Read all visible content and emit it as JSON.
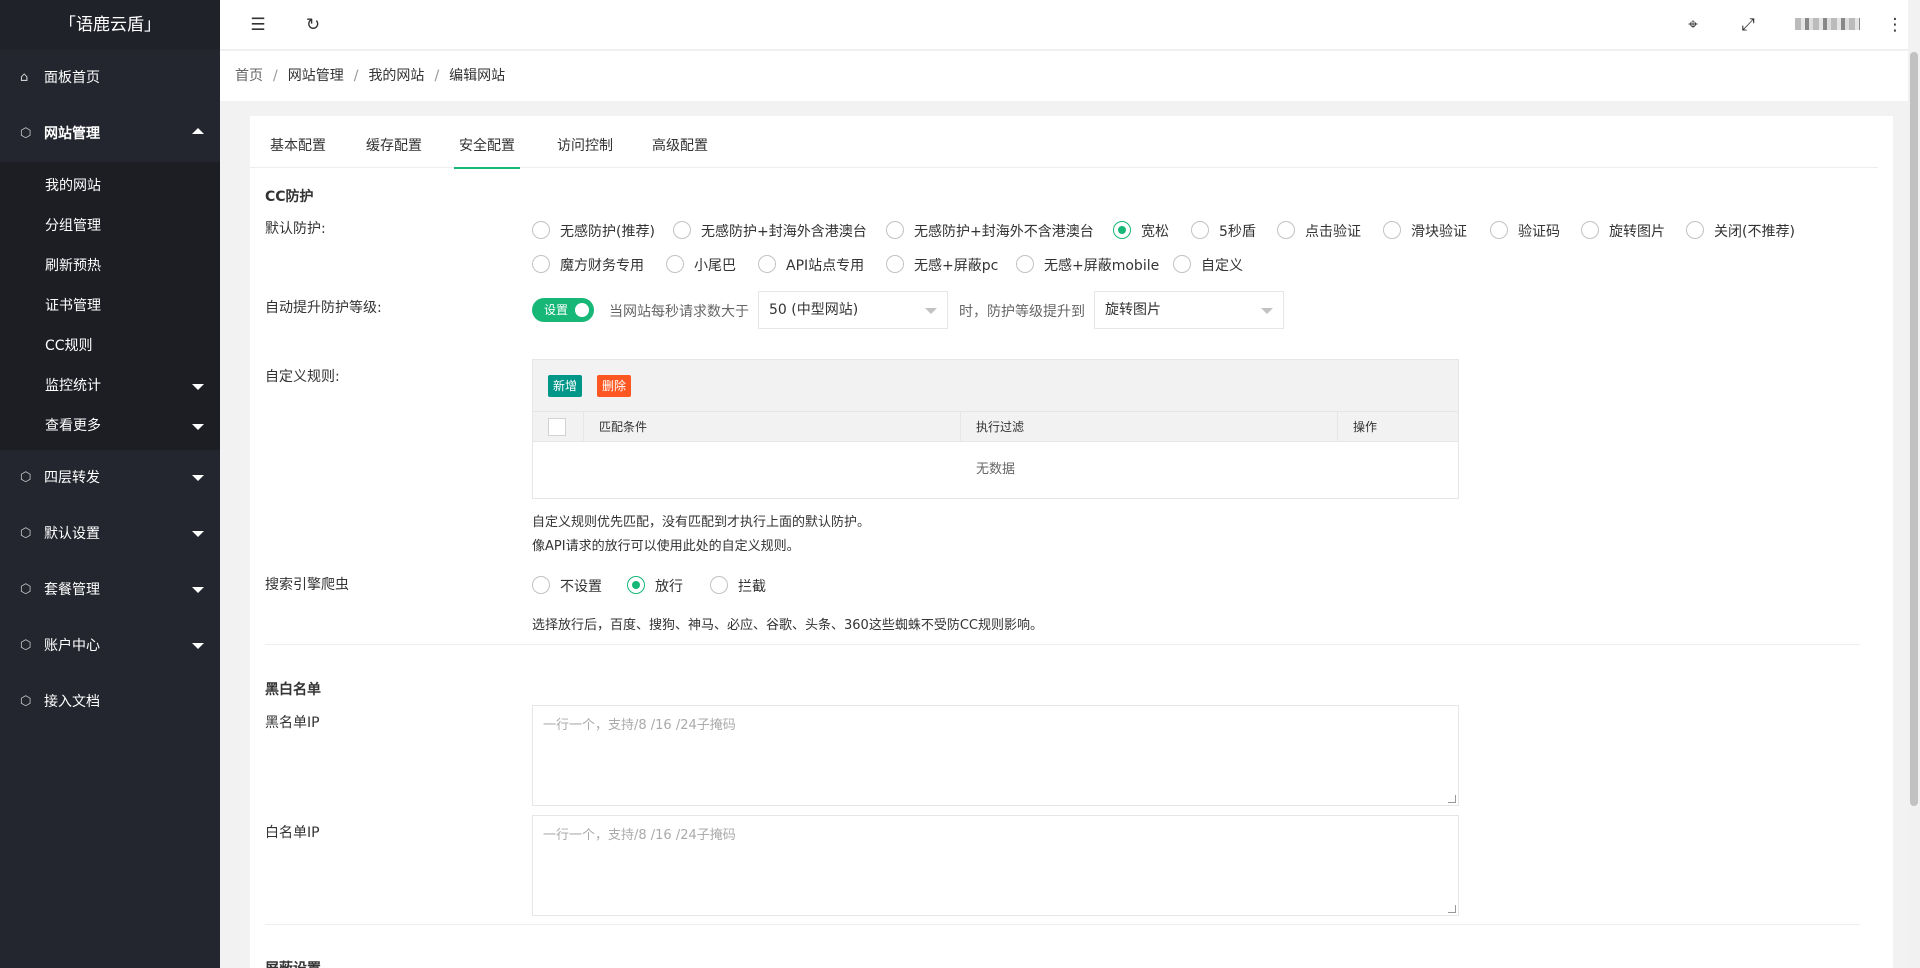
{
  "app": {
    "logo": "「语鹿云盾」"
  },
  "sidebar": {
    "items": [
      {
        "label": "面板首页"
      },
      {
        "label": "网站管理"
      },
      {
        "label": "四层转发"
      },
      {
        "label": "默认设置"
      },
      {
        "label": "套餐管理"
      },
      {
        "label": "账户中心"
      },
      {
        "label": "接入文档"
      }
    ],
    "sub": [
      {
        "label": "我的网站"
      },
      {
        "label": "分组管理"
      },
      {
        "label": "刷新预热"
      },
      {
        "label": "证书管理"
      },
      {
        "label": "CC规则"
      },
      {
        "label": "监控统计"
      },
      {
        "label": "查看更多"
      }
    ]
  },
  "header": {
    "icons": [
      "menu-collapse-icon",
      "refresh-icon",
      "tag-icon",
      "fullscreen-icon",
      "more-vertical-icon"
    ]
  },
  "breadcrumb": [
    "首页",
    "网站管理",
    "我的网站",
    "编辑网站"
  ],
  "tabs": [
    "基本配置",
    "缓存配置",
    "安全配置",
    "访问控制",
    "高级配置"
  ],
  "active_tab": "安全配置",
  "cc": {
    "title": "CC防护",
    "default_label": "默认防护:",
    "options": [
      "无感防护(推荐)",
      "无感防护+封海外含港澳台",
      "无感防护+封海外不含港澳台",
      "宽松",
      "5秒盾",
      "点击验证",
      "滑块验证",
      "验证码",
      "旋转图片",
      "关闭(不推荐)",
      "魔方财务专用",
      "小尾巴",
      "API站点专用",
      "无感+屏蔽pc",
      "无感+屏蔽mobile",
      "自定义"
    ],
    "selected": "宽松",
    "auto_label": "自动提升防护等级:",
    "switch_text": "设置",
    "hint1": "当网站每秒请求数大于",
    "threshold": "50 (中型网站)",
    "hint2": "时，防护等级提升到",
    "level": "旋转图片",
    "custom_label": "自定义规则:",
    "btn_add": "新增",
    "btn_delete": "删除",
    "columns": [
      "匹配条件",
      "执行过滤",
      "操作"
    ],
    "empty": "无数据",
    "note1": "自定义规则优先匹配，没有匹配到才执行上面的默认防护。",
    "note2": "像API请求的放行可以使用此处的自定义规则。",
    "spider_label": "搜索引擎爬虫",
    "spider_options": [
      "不设置",
      "放行",
      "拦截"
    ],
    "spider_selected": "放行",
    "spider_note": "选择放行后，百度、搜狗、神马、必应、谷歌、头条、360这些蜘蛛不受防CC规则影响。"
  },
  "bw": {
    "title": "黑白名单",
    "black_label": "黑名单IP",
    "white_label": "白名单IP",
    "placeholder": "一行一个，支持/8 /16 /24子掩码"
  },
  "next_section": {
    "title": "屏蔽设置"
  },
  "colors": {
    "accent": "#16b777",
    "danger": "#ff5722",
    "teal": "#009688",
    "sidebar": "#23262e"
  }
}
